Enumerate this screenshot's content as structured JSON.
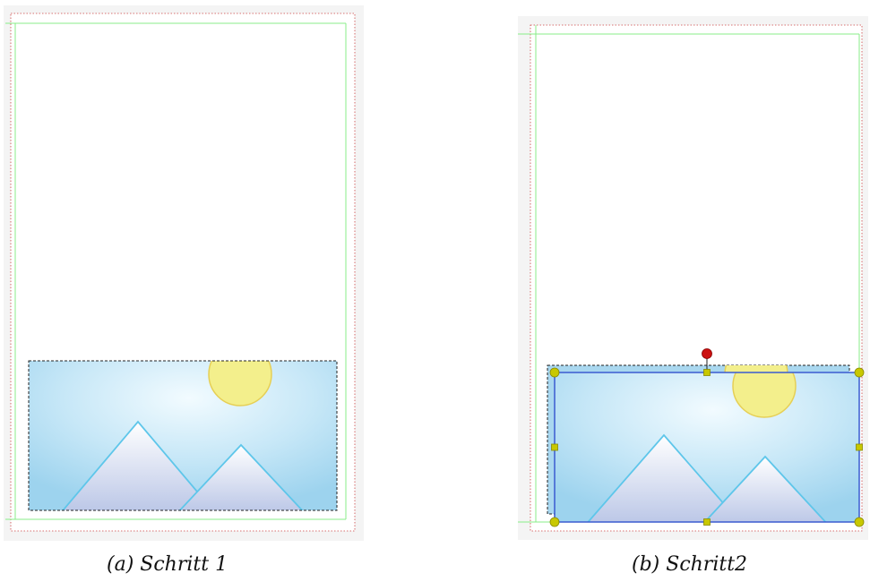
{
  "figure": {
    "panels": [
      {
        "id": "a",
        "caption": "(a) Schritt 1"
      },
      {
        "id": "b",
        "caption": "(b) Schritt2"
      }
    ]
  },
  "colors": {
    "page_bg": "#f4f4f4",
    "margin_guide": "#88ee88",
    "bleed_guide": "#cc4444",
    "sky_light": "#f2fbff",
    "sky_dark": "#9dd3ee",
    "sun_fill": "#f3ef8c",
    "sun_stroke": "#e6cf55",
    "mountain_stroke": "#5ec6ea",
    "selection_frame": "#3b5bd0",
    "handle_yellow": "#c8c800",
    "rotate_handle": "#cc1111"
  }
}
